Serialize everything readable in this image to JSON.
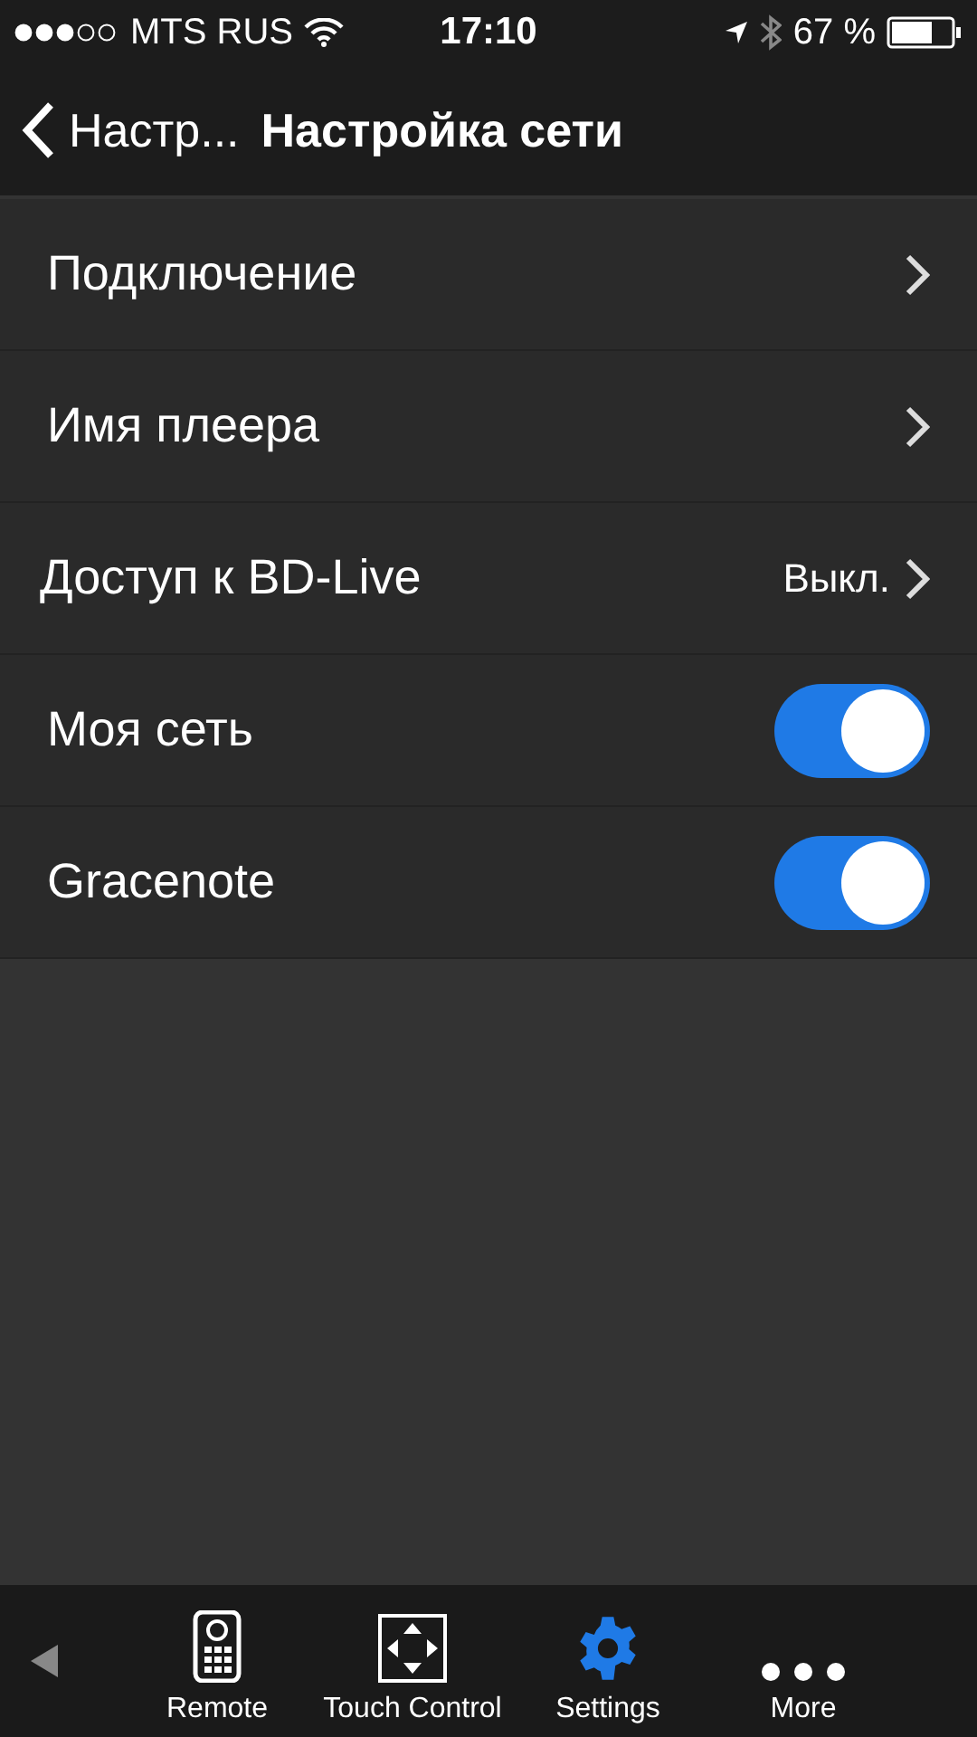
{
  "status_bar": {
    "carrier": "MTS RUS",
    "time": "17:10",
    "battery": "67 %"
  },
  "nav": {
    "back": "Настр...",
    "title": "Настройка сети"
  },
  "rows": [
    {
      "kind": "link",
      "label": "Подключение"
    },
    {
      "kind": "link",
      "label": "Имя плеера"
    },
    {
      "kind": "link",
      "label": "Доступ к BD-Live",
      "value": "Выкл."
    },
    {
      "kind": "toggle",
      "label": "Моя сеть",
      "on": true
    },
    {
      "kind": "toggle",
      "label": "Gracenote",
      "on": true
    }
  ],
  "tabs": [
    {
      "label": "Remote",
      "selected": false
    },
    {
      "label": "Touch Control",
      "selected": false
    },
    {
      "label": "Settings",
      "selected": true
    },
    {
      "label": "More",
      "selected": false
    }
  ]
}
